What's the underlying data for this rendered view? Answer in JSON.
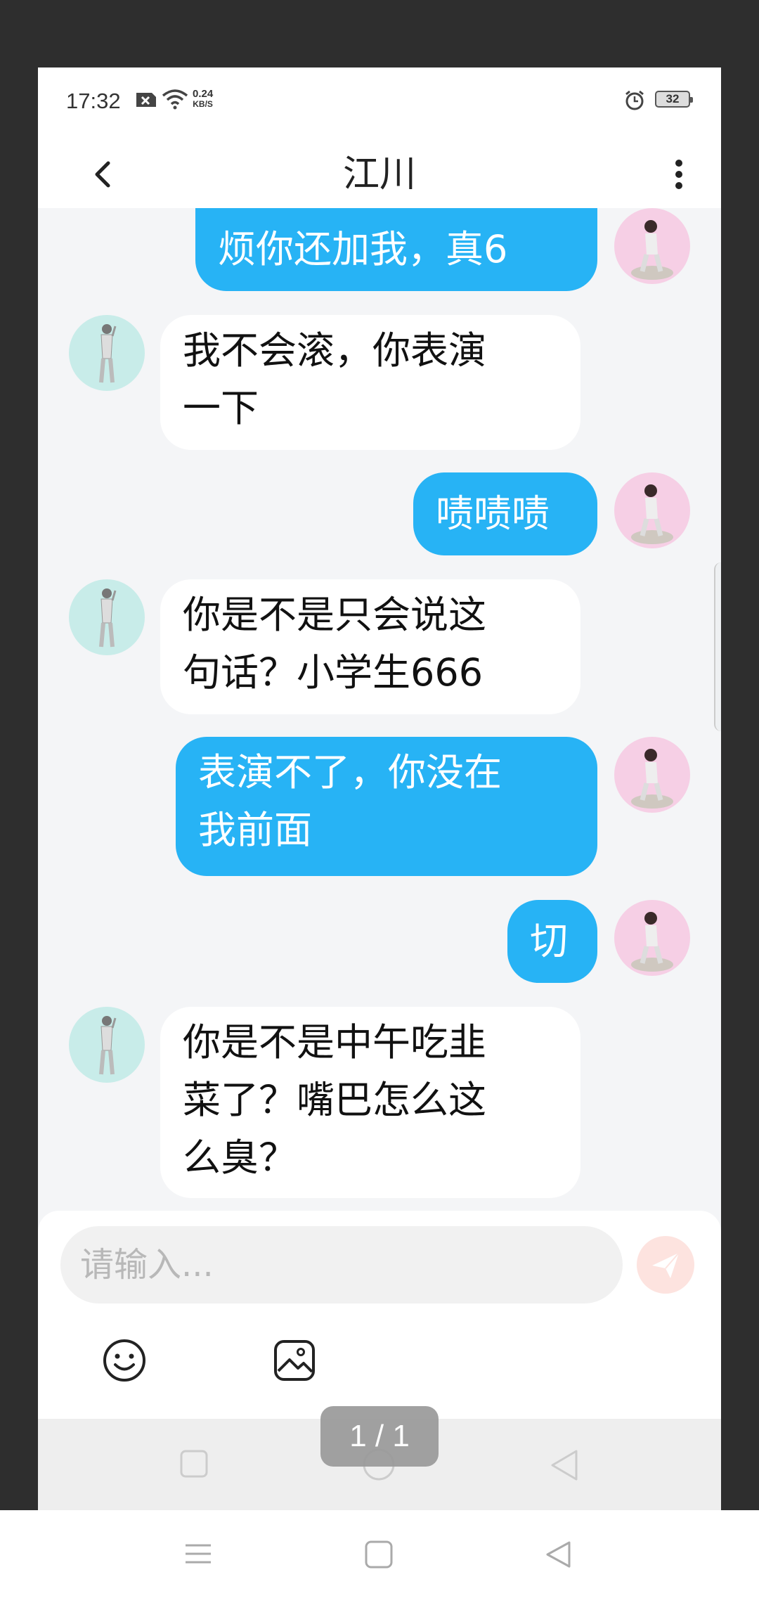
{
  "status_bar": {
    "time": "17:32",
    "network_speed_value": "0.24",
    "network_speed_unit": "KB/S",
    "battery": "32",
    "icons": [
      "sim-x-icon",
      "wifi-icon",
      "alarm-icon",
      "battery-icon"
    ]
  },
  "header": {
    "title": "江川",
    "back_icon": "chevron-left-icon",
    "more_icon": "more-vertical-icon"
  },
  "messages": [
    {
      "side": "out",
      "text": "烦你还加我，真6"
    },
    {
      "side": "in",
      "line1": "我不会滚，你表演",
      "line2": "一下"
    },
    {
      "side": "out",
      "text": "啧啧啧"
    },
    {
      "side": "in",
      "line1": "你是不是只会说这",
      "line2": "句话？小学生666"
    },
    {
      "side": "out",
      "line1": "表演不了，你没在",
      "line2": "我前面"
    },
    {
      "side": "out",
      "text": "切"
    },
    {
      "side": "in",
      "line1": "你是不是中午吃韭",
      "line2": "菜了？嘴巴怎么这",
      "line3": "么臭？"
    }
  ],
  "input": {
    "placeholder": "请输入...",
    "send_icon": "send-icon",
    "tools": [
      "emoji-icon",
      "image-icon"
    ]
  },
  "pager": "1 / 1",
  "colors": {
    "outgoing_bubble": "#27b3f5",
    "incoming_bubble": "#ffffff",
    "chat_background": "#f4f5f7",
    "send_button": "#fde3df"
  }
}
